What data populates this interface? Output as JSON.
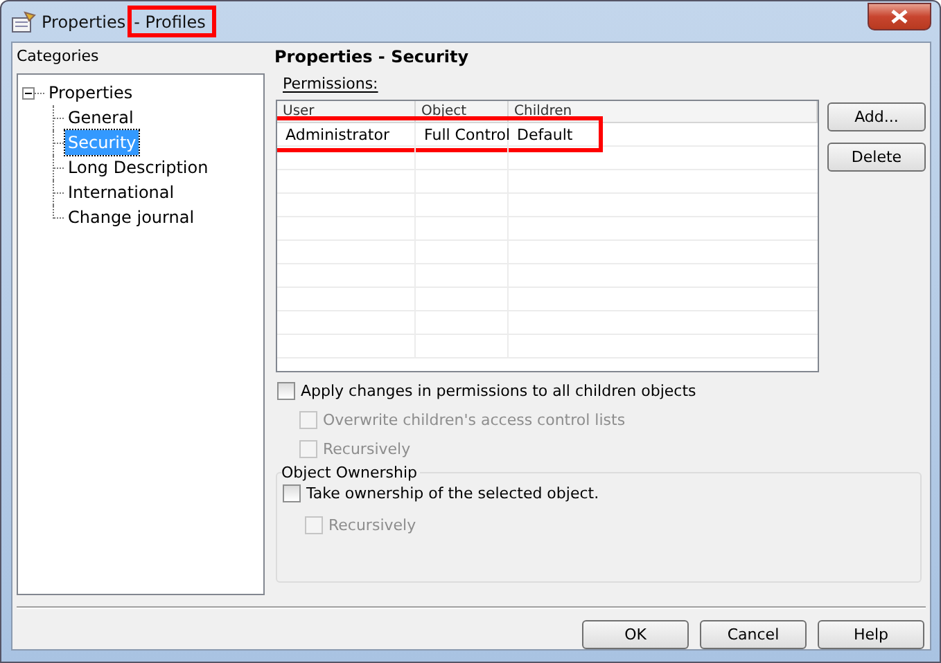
{
  "window": {
    "title": "Properties",
    "title_highlight": "- Profiles"
  },
  "categories": {
    "label": "Categories",
    "tree": {
      "label": "Properties",
      "expanded": true,
      "children": [
        {
          "label": "General",
          "selected": false
        },
        {
          "label": "Security",
          "selected": true
        },
        {
          "label": "Long Description",
          "selected": false
        },
        {
          "label": "International",
          "selected": false
        },
        {
          "label": "Change journal",
          "selected": false
        }
      ]
    }
  },
  "panel": {
    "title": "Properties - Security",
    "permissions_label": "Permissions:",
    "table": {
      "columns": [
        "User",
        "Object",
        "Children"
      ],
      "rows": [
        {
          "cells": [
            "Administrator",
            "Full Control",
            "Default"
          ],
          "highlighted": true
        }
      ]
    },
    "buttons": [
      "Add...",
      "Delete"
    ],
    "checkboxes": [
      {
        "label": "Apply changes in permissions to all children objects",
        "checked": false,
        "disabled": false,
        "indented": false
      },
      {
        "label": "Overwrite children's access control lists",
        "checked": false,
        "disabled": true,
        "indented": true
      },
      {
        "label": "Recursively",
        "checked": false,
        "disabled": true,
        "indented": true
      }
    ],
    "ownership": {
      "title": "Object Ownership",
      "checkboxes": [
        {
          "label": "Take ownership of the selected object.",
          "checked": false,
          "disabled": false,
          "indented": false
        },
        {
          "label": "Recursively",
          "checked": false,
          "disabled": true,
          "indented": true
        }
      ]
    }
  },
  "footer_buttons": [
    "OK",
    "Cancel",
    "Help"
  ]
}
